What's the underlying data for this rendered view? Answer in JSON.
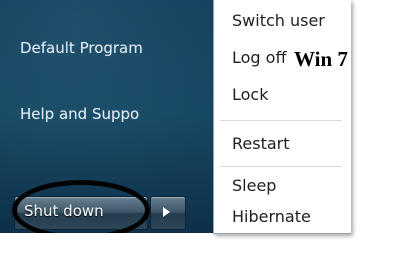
{
  "start_pane": {
    "default_programs": "Default Program",
    "help_support": "Help and Suppo"
  },
  "shutdown": {
    "label": "Shut down",
    "arrow_icon": "right-triangle-icon"
  },
  "power_menu": {
    "items": [
      "Switch user",
      "Log off",
      "Lock",
      "Restart",
      "Sleep",
      "Hibernate"
    ]
  },
  "caption": "Win 7",
  "colors": {
    "pane": "#174863",
    "menu_bg": "#ffffff",
    "highlight_circle": "#000000"
  }
}
